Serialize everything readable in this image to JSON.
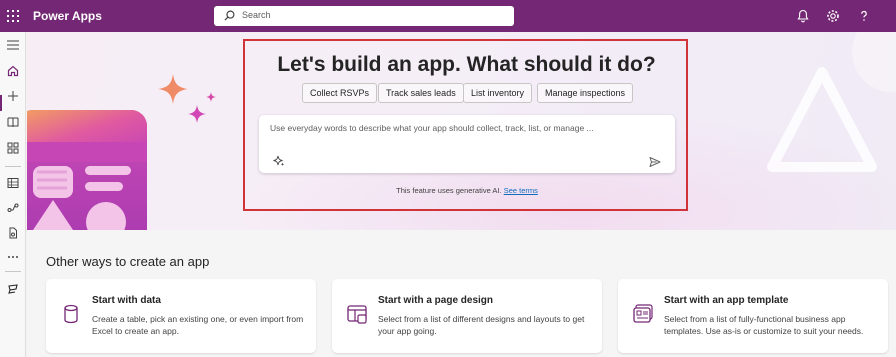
{
  "header": {
    "app_name": "Power Apps",
    "search_placeholder": "Search",
    "icons": [
      "waffle-icon",
      "search-icon",
      "bell-icon",
      "gear-icon",
      "help-icon"
    ]
  },
  "rail": {
    "items": [
      "menu-icon",
      "home-icon",
      "create-icon",
      "learn-icon",
      "apps-icon",
      "tables-icon",
      "flows-icon",
      "solutions-icon",
      "more-icon",
      "power-platform-icon"
    ],
    "active": "home-icon"
  },
  "hero": {
    "title": "Let's build an app. What should it do?",
    "chips": [
      "Collect RSVPs",
      "Track sales leads",
      "List inventory",
      "Manage inspections"
    ],
    "prompt_placeholder": "Use everyday words to describe what your app should collect, track, list, or manage ...",
    "disclaimer_text": "This feature uses generative AI.",
    "disclaimer_link": "See terms"
  },
  "other": {
    "section_title": "Other ways to create an app",
    "cards": [
      {
        "title": "Start with data",
        "desc": "Create a table, pick an existing one, or even import from Excel to create an app.",
        "icon": "database-icon"
      },
      {
        "title": "Start with a page design",
        "desc": "Select from a list of different designs and layouts to get your app going.",
        "icon": "page-design-icon"
      },
      {
        "title": "Start with an app template",
        "desc": "Select from a list of fully-functional business app templates. Use as-is or customize to suit your needs.",
        "icon": "app-template-icon"
      }
    ]
  },
  "colors": {
    "brand": "#742774",
    "highlight_border": "#d13438",
    "link": "#0f6cbd"
  }
}
